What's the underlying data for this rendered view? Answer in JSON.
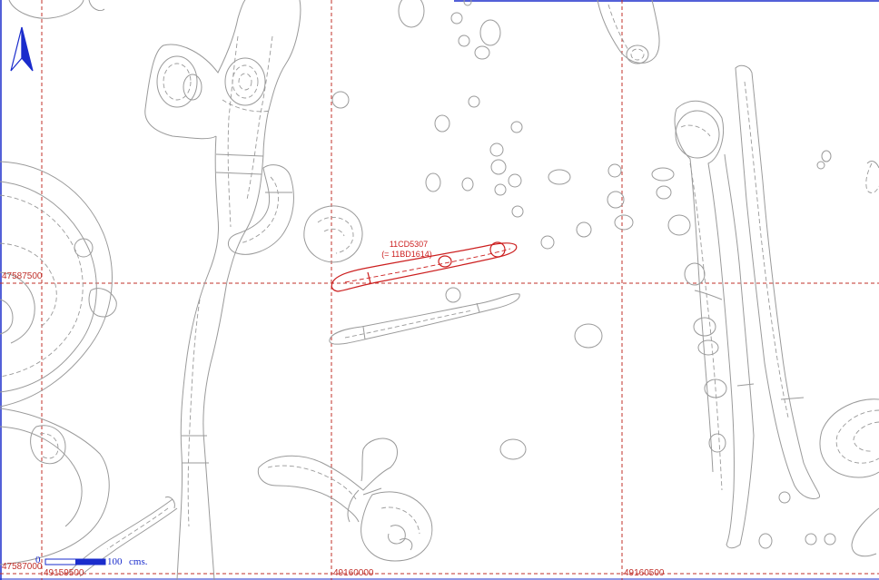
{
  "map": {
    "north_arrow": "north-arrow-icon",
    "colors": {
      "grid": "#c0302a",
      "features": "#9a9a9a",
      "highlight": "#cc1f1f",
      "scale_and_frame": "#1a2ccc"
    },
    "grid": {
      "easting_labels": [
        "49159500",
        "49160000",
        "49160500"
      ],
      "northing_labels": [
        "47587500",
        "47587000"
      ]
    },
    "highlighted_feature": {
      "label_line1": "11CD5307",
      "label_line2": "(= 11BD1614)"
    },
    "scale_bar": {
      "start": "0",
      "end": "100",
      "unit": "cms."
    }
  }
}
